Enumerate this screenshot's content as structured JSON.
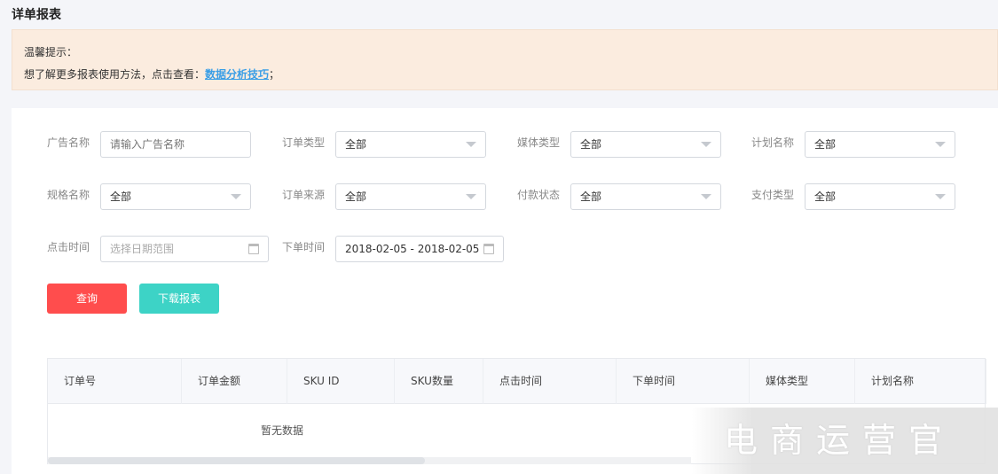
{
  "title": "详单报表",
  "notice": {
    "heading": "温馨提示：",
    "text": "想了解更多报表使用方法，点击查看：",
    "link": "数据分析技巧",
    "suffix": "；"
  },
  "filters": {
    "ad_name": {
      "label": "广告名称",
      "placeholder": "请输入广告名称"
    },
    "order_type": {
      "label": "订单类型",
      "value": "全部"
    },
    "media_type": {
      "label": "媒体类型",
      "value": "全部"
    },
    "plan_name": {
      "label": "计划名称",
      "value": "全部"
    },
    "spec_name": {
      "label": "规格名称",
      "value": "全部"
    },
    "order_source": {
      "label": "订单来源",
      "value": "全部"
    },
    "payment_status": {
      "label": "付款状态",
      "value": "全部"
    },
    "payment_type": {
      "label": "支付类型",
      "value": "全部"
    },
    "click_time": {
      "label": "点击时间",
      "placeholder": "选择日期范围"
    },
    "order_time": {
      "label": "下单时间",
      "value": "2018-02-05 - 2018-02-05"
    }
  },
  "buttons": {
    "query": "查询",
    "download": "下载报表"
  },
  "colors": {
    "query": "#ff4d4d",
    "download": "#3dd3c6",
    "link": "#3a9ee6"
  },
  "table": {
    "columns": [
      "订单号",
      "订单金额",
      "SKU ID",
      "SKU数量",
      "点击时间",
      "下单时间",
      "媒体类型",
      "计划名称"
    ],
    "empty": "暂无数据"
  },
  "watermark": "电商运营官"
}
